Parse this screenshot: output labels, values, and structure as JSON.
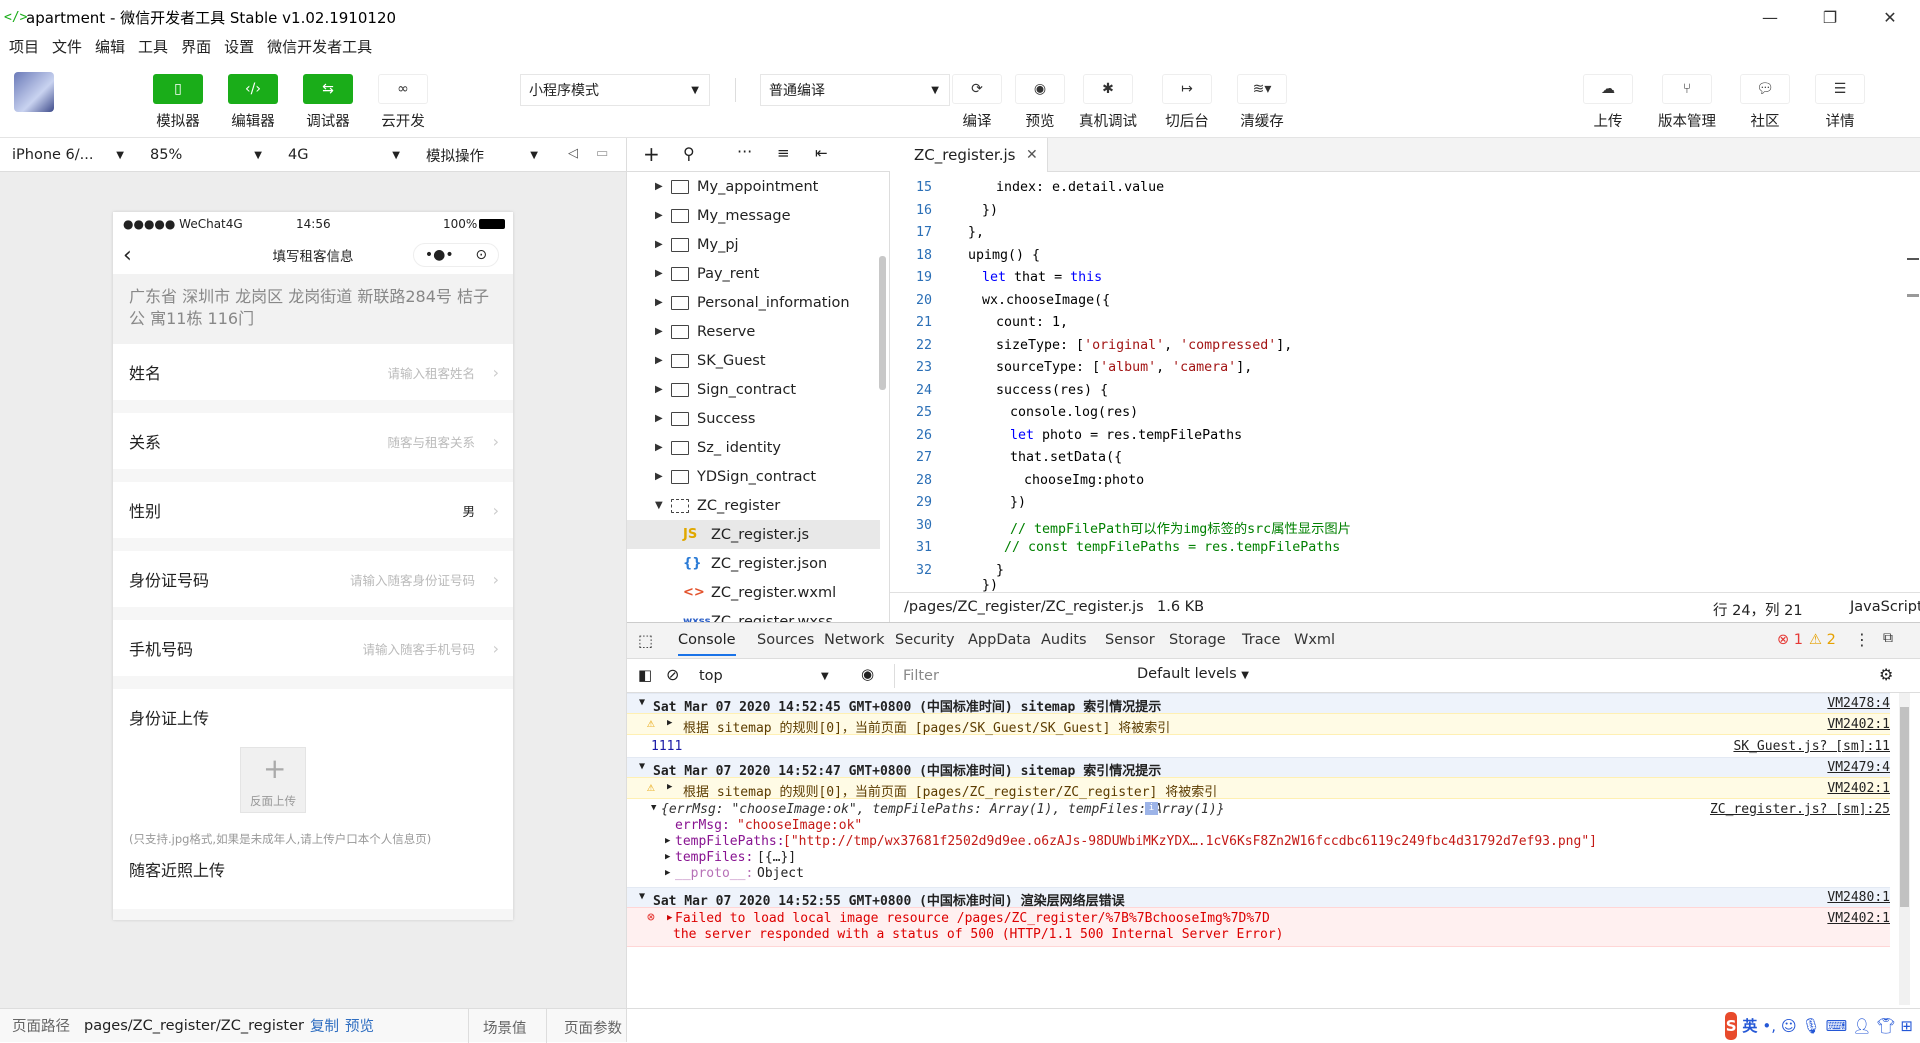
{
  "window": {
    "title": "apartment - 微信开发者工具 Stable v1.02.1910120"
  },
  "menu": [
    "项目",
    "文件",
    "编辑",
    "工具",
    "界面",
    "设置",
    "微信开发者工具"
  ],
  "toolbar": {
    "simulator": "模拟器",
    "editor": "编辑器",
    "debugger": "调试器",
    "cloud": "云开发",
    "mode": "小程序模式",
    "compile": "普通编译",
    "compile_btn": "编译",
    "preview": "预览",
    "real_debug": "真机调试",
    "background": "切后台",
    "clear_cache": "清缓存",
    "upload": "上传",
    "version": "版本管理",
    "community": "社区",
    "details": "详情"
  },
  "simbar": {
    "device": "iPhone 6/...",
    "zoom": "85%",
    "network": "4G",
    "operation": "模拟操作"
  },
  "phone": {
    "carrier": "●●●●● WeChat4G",
    "time": "14:56",
    "battery": "100%",
    "page_title": "填写租客信息",
    "address": "广东省 深圳市 龙岗区 龙岗街道 新联路284号 桔子公 寓11栋 116门",
    "fields": [
      {
        "label": "姓名",
        "value": "请输入租客姓名"
      },
      {
        "label": "关系",
        "value": "随客与租客关系"
      },
      {
        "label": "性别",
        "value": "男"
      },
      {
        "label": "身份证号码",
        "value": "请输入随客身份证号码"
      },
      {
        "label": "手机号码",
        "value": "请输入随客手机号码"
      }
    ],
    "id_upload_title": "身份证上传",
    "upload_btn": "反面上传",
    "note": "(只支持.jpg格式,如果是未成年人,请上传户口本个人信息页)",
    "photo_title": "随客近照上传"
  },
  "simfooter": {
    "path_label": "页面路径",
    "path": "pages/ZC_register/ZC_register",
    "copy": "复制",
    "preview": "预览",
    "scene": "场景值",
    "params": "页面参数"
  },
  "filetree": [
    {
      "name": "My_appointment",
      "type": "folder"
    },
    {
      "name": "My_message",
      "type": "folder"
    },
    {
      "name": "My_pj",
      "type": "folder"
    },
    {
      "name": "Pay_rent",
      "type": "folder"
    },
    {
      "name": "Personal_information",
      "type": "folder"
    },
    {
      "name": "Reserve",
      "type": "folder"
    },
    {
      "name": "SK_Guest",
      "type": "folder"
    },
    {
      "name": "Sign_contract",
      "type": "folder"
    },
    {
      "name": "Success",
      "type": "folder"
    },
    {
      "name": "Sz_ identity",
      "type": "folder"
    },
    {
      "name": "YDSign_contract",
      "type": "folder"
    },
    {
      "name": "ZC_register",
      "type": "open-folder"
    },
    {
      "name": "ZC_register.js",
      "type": "js",
      "icon": "JS"
    },
    {
      "name": "ZC_register.json",
      "type": "json",
      "icon": "{}"
    },
    {
      "name": "ZC_register.wxml",
      "type": "wxml",
      "icon": "<>"
    },
    {
      "name": "ZC_register.wxss",
      "type": "wxss",
      "icon": "wxss"
    }
  ],
  "editor": {
    "tab": "ZC_register.js",
    "lines": [
      {
        "n": "15",
        "indent": 4,
        "segs": [
          [
            "index: e.detail.value",
            ""
          ]
        ]
      },
      {
        "n": "16",
        "indent": 3,
        "segs": [
          [
            "})",
            ""
          ]
        ]
      },
      {
        "n": "17",
        "indent": 2,
        "segs": [
          [
            "},",
            ""
          ]
        ]
      },
      {
        "n": "18",
        "indent": 2,
        "segs": [
          [
            "upimg() {",
            ""
          ]
        ]
      },
      {
        "n": "19",
        "indent": 3,
        "segs": [
          [
            "let",
            "kw"
          ],
          [
            " that = ",
            ""
          ],
          [
            "this",
            "kw"
          ]
        ]
      },
      {
        "n": "20",
        "indent": 3,
        "segs": [
          [
            "wx.chooseImage({",
            ""
          ]
        ]
      },
      {
        "n": "21",
        "indent": 4,
        "segs": [
          [
            "count: 1,",
            ""
          ]
        ]
      },
      {
        "n": "22",
        "indent": 4,
        "segs": [
          [
            "sizeType: [",
            ""
          ],
          [
            "'original'",
            "st"
          ],
          [
            ", ",
            ""
          ],
          [
            "'compressed'",
            "st"
          ],
          [
            "],",
            ""
          ]
        ]
      },
      {
        "n": "23",
        "indent": 4,
        "segs": [
          [
            "sourceType: [",
            ""
          ],
          [
            "'album'",
            "st"
          ],
          [
            ", ",
            ""
          ],
          [
            "'camera'",
            "st"
          ],
          [
            "],",
            ""
          ]
        ]
      },
      {
        "n": "24",
        "indent": 4,
        "segs": [
          [
            "success(res) {",
            ""
          ]
        ]
      },
      {
        "n": "25",
        "indent": 5,
        "segs": [
          [
            "console.log(res)",
            ""
          ]
        ]
      },
      {
        "n": "26",
        "indent": 5,
        "segs": [
          [
            "let",
            "kw"
          ],
          [
            " photo = res.tempFilePaths",
            ""
          ]
        ]
      },
      {
        "n": "27",
        "indent": 5,
        "segs": [
          [
            "that.setData({",
            ""
          ]
        ]
      },
      {
        "n": "28",
        "indent": 6,
        "segs": [
          [
            "chooseImg:photo",
            ""
          ]
        ]
      },
      {
        "n": "29",
        "indent": 5,
        "segs": [
          [
            "})",
            ""
          ]
        ]
      },
      {
        "n": "30",
        "indent": 5,
        "segs": [
          [
            "// tempFilePath可以作为img标签的src属性显示图片",
            "cm"
          ]
        ]
      },
      {
        "n": "31",
        "indent": 4,
        "segs": [
          [
            " // const tempFilePaths = res.tempFilePaths",
            "cm"
          ]
        ]
      },
      {
        "n": "32",
        "indent": 4,
        "segs": [
          [
            "}",
            ""
          ]
        ]
      }
    ]
  },
  "edstatus": {
    "path": "/pages/ZC_register/ZC_register.js",
    "size": "1.6 KB",
    "pos": "行 24，列 21",
    "lang": "JavaScript"
  },
  "devtabs": [
    "Console",
    "Sources",
    "Network",
    "Security",
    "AppData",
    "Audits",
    "Sensor",
    "Storage",
    "Trace",
    "Wxml"
  ],
  "devbadges": {
    "errors": "1",
    "warnings": "2"
  },
  "devfilter": {
    "context": "top",
    "filter_placeholder": "Filter",
    "levels": "Default levels"
  },
  "console": {
    "g1_header": "Sat Mar 07 2020 14:52:45 GMT+0800 (中国标准时间) sitemap 索引情况提示",
    "g1_src": "VM2478:4",
    "g1_warn": "根据 sitemap 的规则[0]，当前页面 [pages/SK_Guest/SK_Guest] 将被索引",
    "g1_warn_src": "VM2402:1",
    "log1": "1111",
    "log1_src": "SK_Guest.js? [sm]:11",
    "g2_header": "Sat Mar 07 2020 14:52:47 GMT+0800 (中国标准时间) sitemap 索引情况提示",
    "g2_src": "VM2479:4",
    "g2_warn": "根据 sitemap 的规则[0]，当前页面 [pages/ZC_register/ZC_register] 将被索引",
    "g2_warn_src": "VM2402:1",
    "obj_summary": "{errMsg: \"chooseImage:ok\", tempFilePaths: Array(1), tempFiles: Array(1)}",
    "obj_src": "ZC_register.js? [sm]:25",
    "obj_errmsg_key": "errMsg:",
    "obj_errmsg_val": "\"chooseImage:ok\"",
    "obj_paths_key": "tempFilePaths:",
    "obj_paths_val": "[\"http://tmp/wx37681f2502d9d9ee.o6zAJs-98DUWbiMKzYDX….1cV6KsF8Zn2W16fccdbc6119c249fbc4d31792d7ef93.png\"]",
    "obj_files_key": "tempFiles:",
    "obj_files_val": "[{…}]",
    "obj_proto_key": "__proto__:",
    "obj_proto_val": "Object",
    "g3_header": "Sat Mar 07 2020 14:52:55 GMT+0800 (中国标准时间) 渲染层网络层错误",
    "g3_src": "VM2480:1",
    "err_line1": "Failed to load local image resource /pages/ZC_register/%7B%7BchooseImg%7D%7D",
    "err_line2": "the server responded with a status of 500 (HTTP/1.1 500 Internal Server Error)",
    "err_src": "VM2402:1"
  },
  "ime": {
    "lang": "英"
  }
}
